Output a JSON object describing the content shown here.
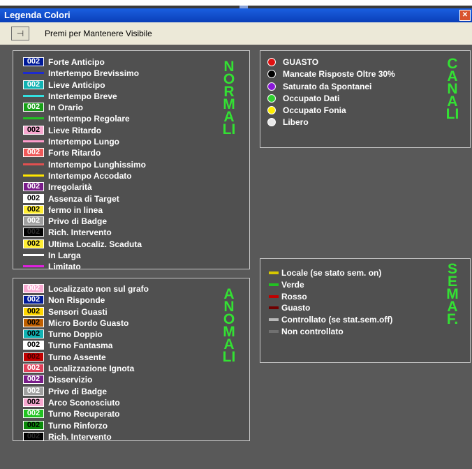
{
  "window": {
    "title": "Legenda Colori",
    "close_glyph": "✕"
  },
  "toolbar": {
    "pin_icon": "pin-icon",
    "pin_glyph": "⊣",
    "label": "Premi per Mantenere Visibile"
  },
  "colors": {
    "panel_bg": "#505050",
    "content_bg": "#595959",
    "green_text": "#33e133",
    "titlebar": "#1a5fe0"
  },
  "normali": {
    "title": "NORMALI",
    "items": [
      {
        "kind": "badge",
        "code": "002",
        "label": "Forte Anticipo",
        "fg": "#ffffff",
        "bg": "#001a99"
      },
      {
        "kind": "line",
        "label": "Intertempo Brevissimo",
        "color": "#1d2bd0"
      },
      {
        "kind": "badge",
        "code": "002",
        "label": "Lieve Anticipo",
        "fg": "#ffffff",
        "bg": "#10b2b2"
      },
      {
        "kind": "line",
        "label": "Intertempo Breve",
        "color": "#33e0e0"
      },
      {
        "kind": "badge",
        "code": "002",
        "label": "In Orario",
        "fg": "#ffffff",
        "bg": "#18a018"
      },
      {
        "kind": "line",
        "label": "Intertempo Regolare",
        "color": "#22c222"
      },
      {
        "kind": "badge",
        "code": "002",
        "label": "Lieve Ritardo",
        "fg": "#000000",
        "bg": "#f7a8d0"
      },
      {
        "kind": "line",
        "label": "Intertempo Lungo",
        "color": "#ff9ccc"
      },
      {
        "kind": "badge",
        "code": "002",
        "label": "Forte Ritardo",
        "fg": "#ffffff",
        "bg": "#f05a5a"
      },
      {
        "kind": "line",
        "label": "Intertempo Lunghissimo",
        "color": "#e05050"
      },
      {
        "kind": "line",
        "label": "Intertempo Accodato",
        "color": "#ffe600"
      },
      {
        "kind": "badge",
        "code": "002",
        "label": "Irregolarità",
        "fg": "#ffffff",
        "bg": "#7a1c8a"
      },
      {
        "kind": "badge",
        "code": "002",
        "label": "Assenza di Target",
        "fg": "#000000",
        "bg": "#ffffff"
      },
      {
        "kind": "badge",
        "code": "002",
        "label": "fermo in linea",
        "fg": "#000000",
        "bg": "#ffee33"
      },
      {
        "kind": "badge",
        "code": "002",
        "label": "Privo di Badge",
        "fg": "#ffffff",
        "bg": "#a0a0a0"
      },
      {
        "kind": "badge",
        "code": "002",
        "label": "Rich. Intervento",
        "fg": "#2a2a2a",
        "bg": "#000000"
      },
      {
        "kind": "badge",
        "code": "002",
        "label": "Ultima Localiz. Scaduta",
        "fg": "#000000",
        "bg": "#ffee33"
      },
      {
        "kind": "line",
        "label": "In Larga",
        "color": "#ffffff"
      },
      {
        "kind": "line",
        "label": "Limitato",
        "color": "#e020e0"
      }
    ]
  },
  "anomali": {
    "title": "ANOMALI",
    "items": [
      {
        "kind": "badge",
        "code": "002",
        "label": "Localizzato non sul grafo",
        "fg": "#ffffff",
        "bg": "#f7a8d0"
      },
      {
        "kind": "badge",
        "code": "002",
        "label": "Non Risponde",
        "fg": "#ffffff",
        "bg": "#001a99"
      },
      {
        "kind": "badge",
        "code": "002",
        "label": "Sensori Guasti",
        "fg": "#000000",
        "bg": "#ffd700"
      },
      {
        "kind": "badge",
        "code": "002",
        "label": "Micro Bordo Guasto",
        "fg": "#000000",
        "bg": "#c06000"
      },
      {
        "kind": "badge",
        "code": "002",
        "label": "Turno Doppio",
        "fg": "#000000",
        "bg": "#10b2b2"
      },
      {
        "kind": "badge",
        "code": "002",
        "label": "Turno Fantasma",
        "fg": "#000000",
        "bg": "#ffffff"
      },
      {
        "kind": "badge",
        "code": "002",
        "label": "Turno Assente",
        "fg": "#4a0000",
        "bg": "#c00000"
      },
      {
        "kind": "badge",
        "code": "002",
        "label": "Localizzazione Ignota",
        "fg": "#ffffff",
        "bg": "#e0405a"
      },
      {
        "kind": "badge",
        "code": "002",
        "label": "Disservizio",
        "fg": "#ffffff",
        "bg": "#7a1c8a"
      },
      {
        "kind": "badge",
        "code": "002",
        "label": "Privo di Badge",
        "fg": "#ffffff",
        "bg": "#a0a0a0"
      },
      {
        "kind": "badge",
        "code": "002",
        "label": "Arco Sconosciuto",
        "fg": "#000000",
        "bg": "#f7a8d0"
      },
      {
        "kind": "badge",
        "code": "002",
        "label": "Turno Recuperato",
        "fg": "#ffffff",
        "bg": "#22c222"
      },
      {
        "kind": "badge",
        "code": "002",
        "label": "Turno Rinforzo",
        "fg": "#000000",
        "bg": "#0a8a0a"
      },
      {
        "kind": "badge",
        "code": "002",
        "label": "Rich. Intervento",
        "fg": "#2a2a2a",
        "bg": "#000000"
      }
    ]
  },
  "canali": {
    "title": "CANALI",
    "items": [
      {
        "label": "GUASTO",
        "color": "#e01010"
      },
      {
        "label": "Mancate Risposte Oltre 30%",
        "color": "#000000"
      },
      {
        "label": "Saturato da Spontanei",
        "color": "#8a18d8"
      },
      {
        "label": "Occupato Dati",
        "color": "#30d030"
      },
      {
        "label": "Occupato Fonia",
        "color": "#ffee00"
      },
      {
        "label": "Libero",
        "color": "#e8e8e8"
      }
    ]
  },
  "semaf": {
    "title": "SEMAF.",
    "items": [
      {
        "label": "Locale (se stato sem. on)",
        "color": "#d8c800"
      },
      {
        "label": "Verde",
        "color": "#22c222"
      },
      {
        "label": "Rosso",
        "color": "#c00000"
      },
      {
        "label": "Guasto",
        "color": "#700000"
      },
      {
        "label": "Controllato (se stat.sem.off)",
        "color": "#b8b8b8"
      },
      {
        "label": "Non controllato",
        "color": "#707070"
      }
    ]
  }
}
